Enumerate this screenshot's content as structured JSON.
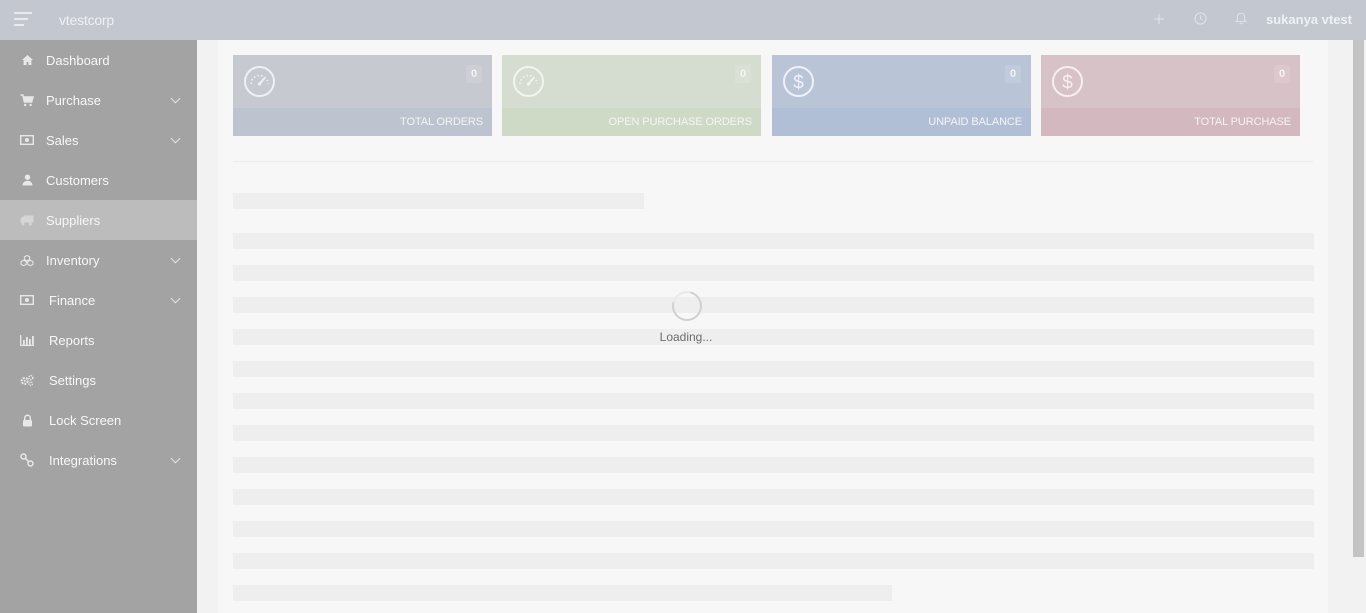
{
  "topbar": {
    "brand": "vtestcorp",
    "user": "sukanya vtest",
    "icons": [
      "plus-icon",
      "clock-icon",
      "bell-icon"
    ]
  },
  "sidebar": {
    "items": [
      {
        "label": "Dashboard",
        "icon": "home-icon",
        "expandable": false,
        "active": false
      },
      {
        "label": "Purchase",
        "icon": "cart-icon",
        "expandable": true,
        "active": false
      },
      {
        "label": "Sales",
        "icon": "money-icon",
        "expandable": true,
        "active": false
      },
      {
        "label": "Customers",
        "icon": "user-icon",
        "expandable": false,
        "active": false
      },
      {
        "label": "Suppliers",
        "icon": "truck-icon",
        "expandable": false,
        "active": true
      },
      {
        "label": "Inventory",
        "icon": "cubes-icon",
        "expandable": true,
        "active": false
      },
      {
        "label": "Finance",
        "icon": "money-icon",
        "expandable": true,
        "active": false
      },
      {
        "label": "Reports",
        "icon": "bar-chart-icon",
        "expandable": false,
        "active": false
      },
      {
        "label": "Settings",
        "icon": "gears-icon",
        "expandable": false,
        "active": false
      },
      {
        "label": "Lock Screen",
        "icon": "lock-icon",
        "expandable": false,
        "active": false
      },
      {
        "label": "Integrations",
        "icon": "link-icon",
        "expandable": true,
        "active": false
      }
    ]
  },
  "cards": [
    {
      "label": "TOTAL ORDERS",
      "value": "0",
      "icon": "dashboard-gauge-icon",
      "top_color": "#c6c9d0",
      "bottom_color": "#bdc4d0"
    },
    {
      "label": "OPEN PURCHASE ORDERS",
      "value": "0",
      "icon": "dashboard-gauge-icon",
      "top_color": "#d5dcd0",
      "bottom_color": "#cfdac6"
    },
    {
      "label": "UNPAID BALANCE",
      "value": "0",
      "icon": "dollar-icon",
      "top_color": "#b9c4d6",
      "bottom_color": "#b1bfd6"
    },
    {
      "label": "TOTAL PURCHASE",
      "value": "0",
      "icon": "dollar-icon",
      "top_color": "#d7c2c8",
      "bottom_color": "#d4b8c0"
    }
  ],
  "loading": {
    "text": "Loading..."
  }
}
